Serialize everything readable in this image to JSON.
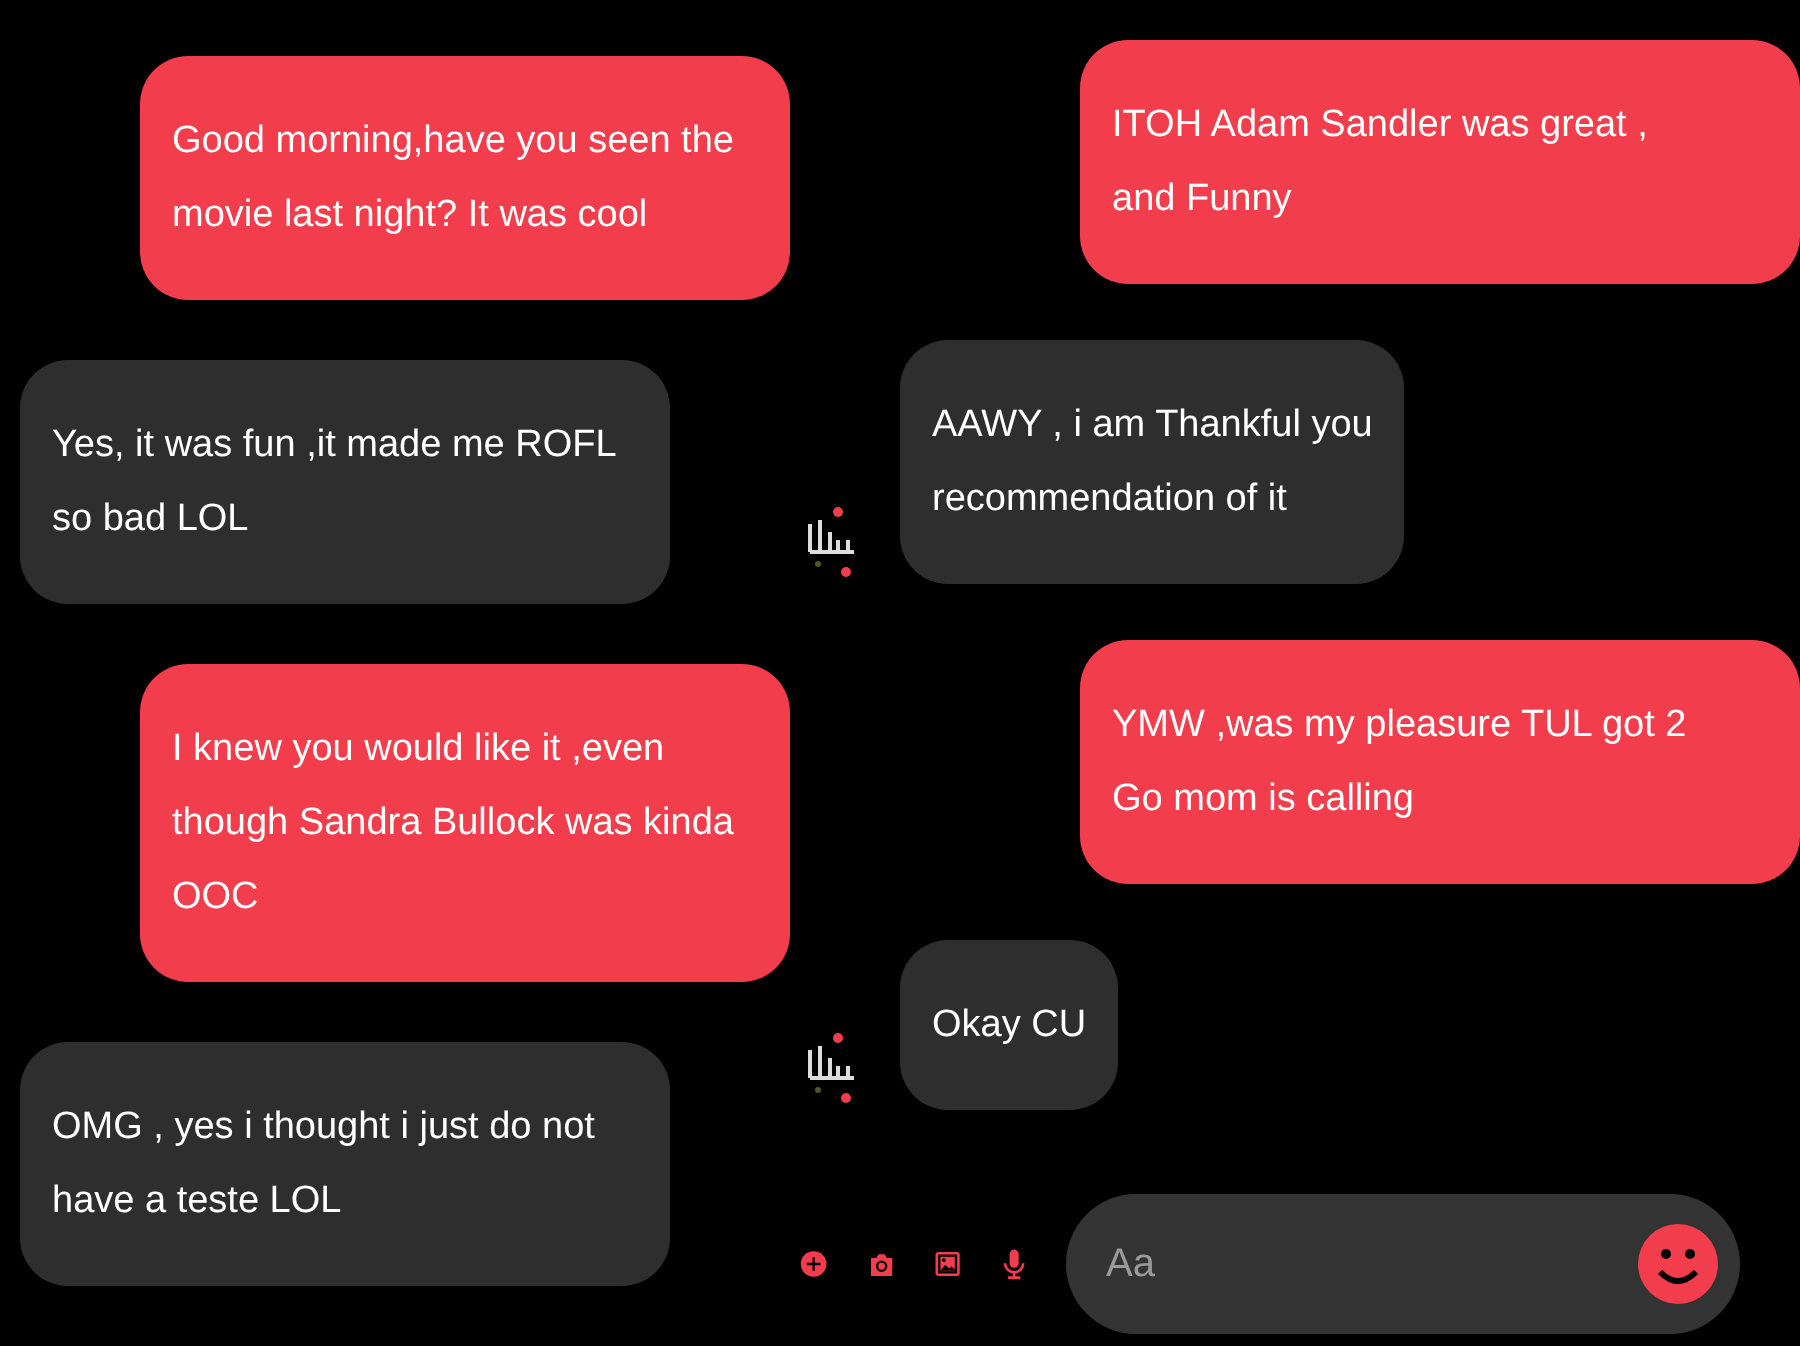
{
  "panels": [
    {
      "messages": [
        {
          "kind": "sent",
          "avatar": false,
          "text": "Good morning,have you seen the\nmovie last night? It was cool"
        },
        {
          "kind": "received",
          "avatar": false,
          "text": "Yes, it was fun ,it made me ROFL\nso bad LOL"
        },
        {
          "kind": "sent",
          "avatar": false,
          "text": "I knew you would like it ,even\nthough Sandra Bullock was kinda\nOOC"
        },
        {
          "kind": "received",
          "avatar": false,
          "text": "OMG , yes i thought i just do not\nhave a teste LOL"
        }
      ]
    },
    {
      "messages": [
        {
          "kind": "sent",
          "avatar": false,
          "text": "ITOH Adam Sandler  was great ,\nand Funny"
        },
        {
          "kind": "received",
          "avatar": true,
          "text": "AAWY , i am Thankful you\nrecommendation of it"
        },
        {
          "kind": "sent",
          "avatar": false,
          "text": "YMW ,was my pleasure TUL got 2\nGo mom is calling"
        },
        {
          "kind": "received",
          "avatar": true,
          "text": "Okay CU"
        }
      ],
      "composer": {
        "placeholder": "Aa"
      }
    }
  ]
}
